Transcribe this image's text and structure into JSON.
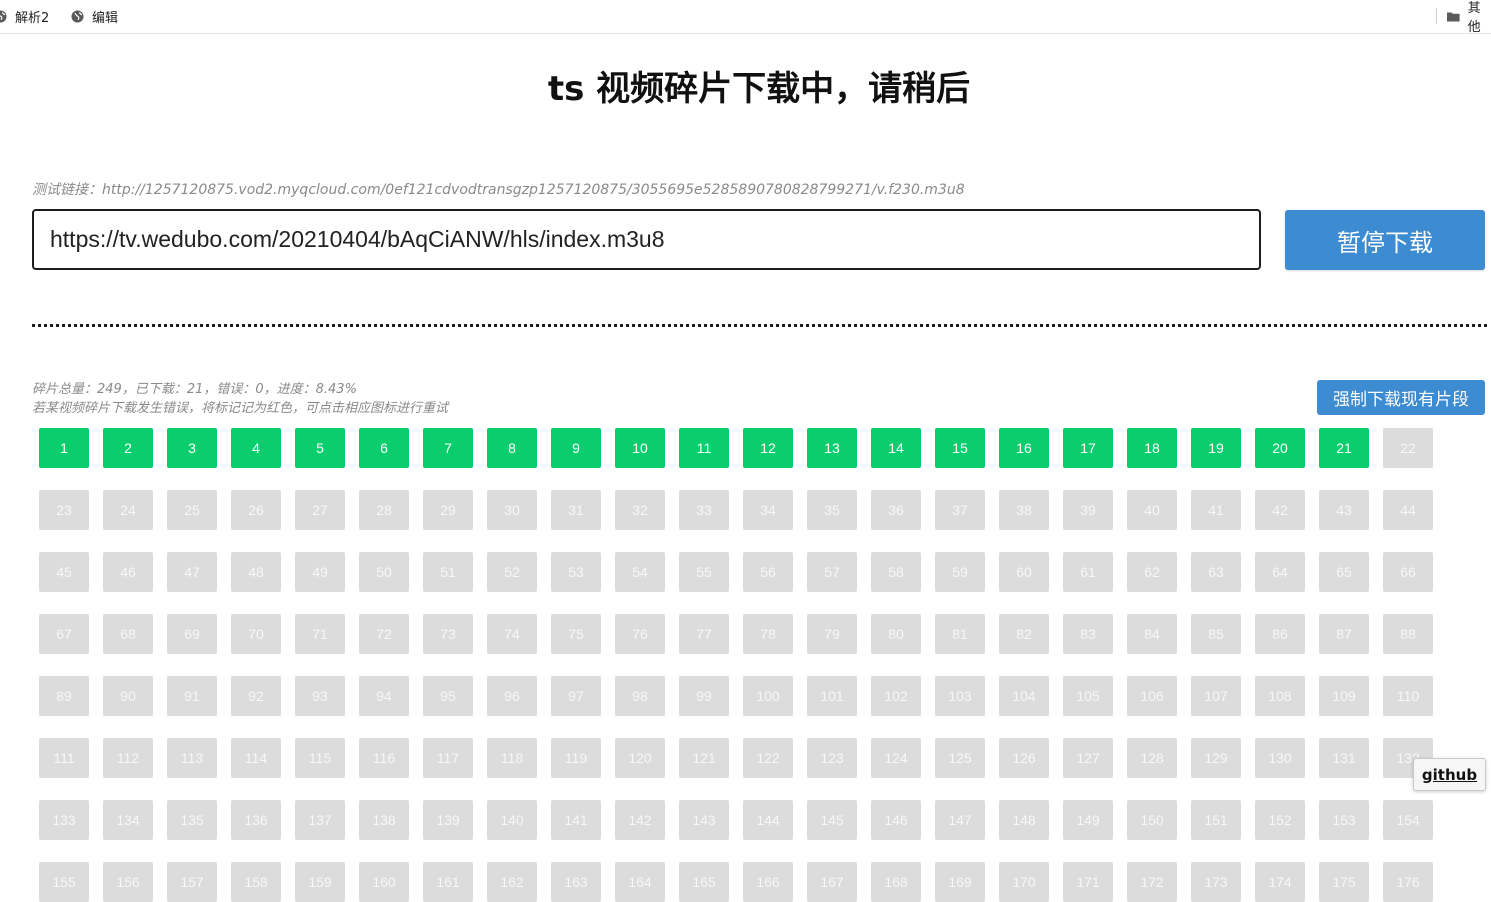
{
  "bookmarks": {
    "items": [
      {
        "label": "解析2",
        "icon": "globe-icon"
      },
      {
        "label": "编辑",
        "icon": "globe-icon"
      }
    ],
    "other": {
      "label": "其他",
      "icon": "folder-icon"
    }
  },
  "header": {
    "title": "ts 视频碎片下载中，请稍后"
  },
  "form": {
    "test_link": "测试链接：http://1257120875.vod2.myqcloud.com/0ef121cdvodtransgzp1257120875/3055695e5285890780828799271/v.f230.m3u8",
    "url_value": "https://tv.wedubo.com/20210404/bAqCiANW/hls/index.m3u8",
    "pause_label": "暂停下载"
  },
  "status": {
    "summary": "碎片总量：249，已下载：21，错误：0，进度：8.43%",
    "hint": "若某视频碎片下载发生错误，将标记记为红色，可点击相应图标进行重试",
    "force_label": "强制下载现有片段"
  },
  "segments": {
    "total": 249,
    "downloaded": 21,
    "errors": 0,
    "progress_percent": 8.43
  },
  "github": {
    "label": "github"
  },
  "colors": {
    "done": "#0acd6e",
    "pending": "#dcdcdc",
    "accent": "#3d8bd0"
  }
}
